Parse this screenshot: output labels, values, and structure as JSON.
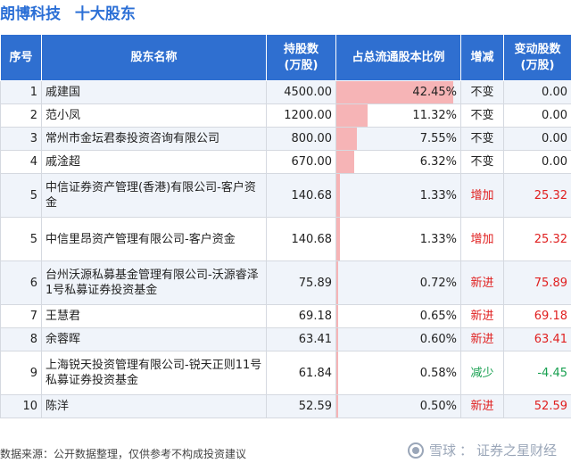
{
  "header": {
    "company": "朗博科技",
    "subtitle": "十大股东"
  },
  "columns": [
    "序号",
    "股东名称",
    "持股数\n(万股)",
    "占总流通股本比例",
    "增减",
    "变动股数\n(万股)"
  ],
  "columns_split": {
    "c0": "序号",
    "c1": "股东名称",
    "c2a": "持股数",
    "c2b": "(万股)",
    "c3": "占总流通股本比例",
    "c4": "增减",
    "c5a": "变动股数",
    "c5b": "(万股)"
  },
  "rows": [
    {
      "idx": "1",
      "name": "戚建国",
      "shares": "4500.00",
      "ratio": "42.45%",
      "ratio_value": 42.45,
      "change": "不变",
      "change_type": "same",
      "delta": "0.00"
    },
    {
      "idx": "2",
      "name": "范小凤",
      "shares": "1200.00",
      "ratio": "11.32%",
      "ratio_value": 11.32,
      "change": "不变",
      "change_type": "same",
      "delta": "0.00"
    },
    {
      "idx": "3",
      "name": "常州市金坛君泰投资咨询有限公司",
      "shares": "800.00",
      "ratio": "7.55%",
      "ratio_value": 7.55,
      "change": "不变",
      "change_type": "same",
      "delta": "0.00"
    },
    {
      "idx": "4",
      "name": "戚淦超",
      "shares": "670.00",
      "ratio": "6.32%",
      "ratio_value": 6.32,
      "change": "不变",
      "change_type": "same",
      "delta": "0.00"
    },
    {
      "idx": "5",
      "name": "中信证券资产管理(香港)有限公司-客户资金",
      "shares": "140.68",
      "ratio": "1.33%",
      "ratio_value": 1.33,
      "change": "增加",
      "change_type": "up",
      "delta": "25.32"
    },
    {
      "idx": "5",
      "name": "中信里昂资产管理有限公司-客户资金",
      "shares": "140.68",
      "ratio": "1.33%",
      "ratio_value": 1.33,
      "change": "增加",
      "change_type": "up",
      "delta": "25.32"
    },
    {
      "idx": "6",
      "name": "台州沃源私募基金管理有限公司-沃源睿泽1号私募证券投资基金",
      "shares": "75.89",
      "ratio": "0.72%",
      "ratio_value": 0.72,
      "change": "新进",
      "change_type": "up",
      "delta": "75.89"
    },
    {
      "idx": "7",
      "name": "王慧君",
      "shares": "69.18",
      "ratio": "0.65%",
      "ratio_value": 0.65,
      "change": "新进",
      "change_type": "up",
      "delta": "69.18"
    },
    {
      "idx": "8",
      "name": "余蓉晖",
      "shares": "63.41",
      "ratio": "0.60%",
      "ratio_value": 0.6,
      "change": "新进",
      "change_type": "up",
      "delta": "63.41"
    },
    {
      "idx": "9",
      "name": "上海锐天投资管理有限公司-锐天正则11号私募证券投资基金",
      "shares": "61.84",
      "ratio": "0.58%",
      "ratio_value": 0.58,
      "change": "减少",
      "change_type": "down",
      "delta": "-4.45"
    },
    {
      "idx": "10",
      "name": "陈洋",
      "shares": "52.59",
      "ratio": "0.50%",
      "ratio_value": 0.5,
      "change": "新进",
      "change_type": "up",
      "delta": "52.59"
    }
  ],
  "footer": {
    "source": "数据来源：公开数据整理，仅供参考不构成投资建议"
  },
  "watermark": {
    "brand": "雪球",
    "sep": "：",
    "author": "证券之星财经"
  },
  "colors": {
    "header_bg": "#2f6fd0",
    "title": "#2b6fd6",
    "bar": "#f6b4b6",
    "increase": "#e02020",
    "decrease": "#18a050"
  }
}
